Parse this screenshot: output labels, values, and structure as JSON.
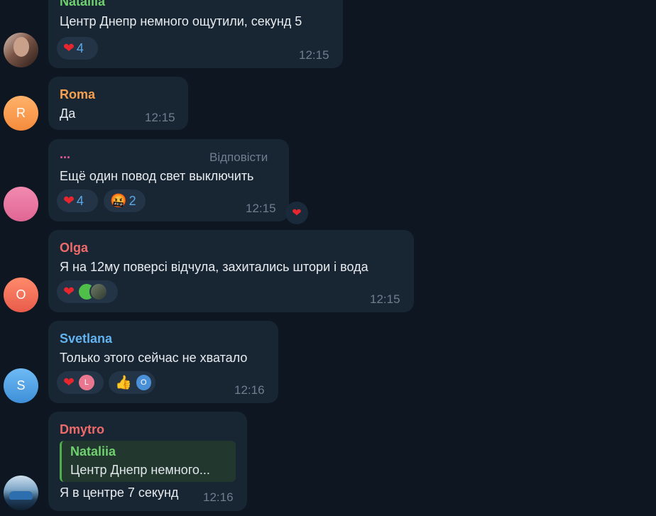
{
  "colors": {
    "background": "#0e1621",
    "bubble": "#182533",
    "time": "#6e7f8f",
    "reaction_count": "#5ba8e6",
    "nataliia": "#6fd06e",
    "roma": "#f5a04e",
    "anon": "#e35b9e",
    "olga": "#ef6a6a",
    "svetlana": "#62b3ef",
    "dmytro": "#ef6a6a"
  },
  "messages": [
    {
      "sender": "Nataliia",
      "text": "Центр Днепр немного ощутили, секунд 5",
      "time": "12:15",
      "reactions": [
        {
          "emoji": "❤",
          "count": "4"
        }
      ]
    },
    {
      "sender": "Roma",
      "avatar_letter": "R",
      "text": "Да",
      "time": "12:15"
    },
    {
      "sender": "...",
      "reply_label": "Відповісти",
      "text": "Ещё один повод свет выключить",
      "time": "12:15",
      "reactions": [
        {
          "emoji": "❤",
          "count": "4"
        },
        {
          "emoji": "🤬",
          "count": "2"
        }
      ],
      "side_reaction": "❤"
    },
    {
      "sender": "Olga",
      "avatar_letter": "O",
      "text": "Я на 12му поверсі відчула, захитались штори і вода",
      "time": "12:15",
      "reactions": [
        {
          "emoji": "❤"
        }
      ]
    },
    {
      "sender": "Svetlana",
      "avatar_letter": "S",
      "text": "Только этого сейчас не хватало",
      "time": "12:16",
      "reactions": [
        {
          "emoji": "❤",
          "avatar_letter": "L"
        },
        {
          "emoji": "👍",
          "avatar_letter": "O"
        }
      ]
    },
    {
      "sender": "Dmytro",
      "quote": {
        "name": "Nataliia",
        "text": "Центр Днепр немного..."
      },
      "text": "Я в центре 7 секунд",
      "time": "12:16"
    }
  ]
}
